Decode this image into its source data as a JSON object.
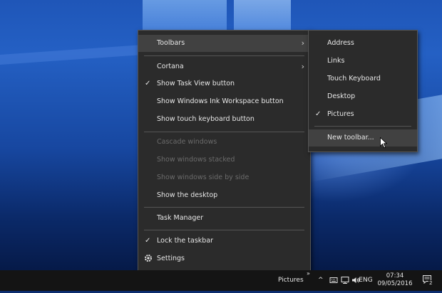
{
  "main_menu": {
    "toolbars": "Toolbars",
    "cortana": "Cortana",
    "show_task_view": "Show Task View button",
    "show_ink": "Show Windows Ink Workspace button",
    "show_touch_kb": "Show touch keyboard button",
    "cascade": "Cascade windows",
    "stacked": "Show windows stacked",
    "side_by_side": "Show windows side by side",
    "show_desktop": "Show the desktop",
    "task_manager": "Task Manager",
    "lock_taskbar": "Lock the taskbar",
    "settings": "Settings"
  },
  "toolbars_submenu": {
    "address": "Address",
    "links": "Links",
    "touch_keyboard": "Touch Keyboard",
    "desktop": "Desktop",
    "pictures": "Pictures",
    "new_toolbar": "New toolbar..."
  },
  "glyphs": {
    "check": "✓",
    "submenu_arrow": "›",
    "chevron_up": "^",
    "double_chevron": "»"
  },
  "taskbar": {
    "pictures_toolbar": "Pictures",
    "language": "ENG",
    "time": "07:34",
    "date": "09/05/2016",
    "notification_count": "2"
  },
  "icons": [
    "gear-icon",
    "chevron-up-icon",
    "touch-keyboard-icon",
    "network-icon",
    "volume-icon",
    "action-center-icon",
    "cursor-icon"
  ]
}
